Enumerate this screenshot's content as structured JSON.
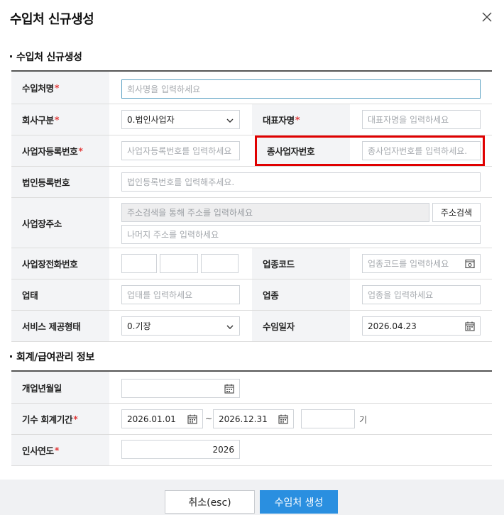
{
  "dialog": {
    "title": "수입처 신규생성",
    "close_label": "×"
  },
  "section1": {
    "heading": "수입처 신규생성",
    "fields": {
      "name_label": "수입처명",
      "name_placeholder": "회사명을 입력하세요",
      "company_type_label": "회사구분",
      "company_type_value": "0.법인사업자",
      "ceo_label": "대표자명",
      "ceo_placeholder": "대표자명을 입력하세요",
      "biz_no_label": "사업자등록번호",
      "biz_no_placeholder": "사업자등록번호를 입력하세요",
      "sub_biz_no_label": "종사업자번호",
      "sub_biz_no_placeholder": "종사업자번호를 입력하세요.",
      "corp_no_label": "법인등록번호",
      "corp_no_placeholder": "법인등록번호를 입력해주세요.",
      "address_label": "사업장주소",
      "address_placeholder": "주소검색을 통해 주소를 입력하세요",
      "address_search_button": "주소검색",
      "address_detail_placeholder": "나머지 주소를 입력하세요",
      "phone_label": "사업장전화번호",
      "industry_code_label": "업종코드",
      "industry_code_placeholder": "업종코드를 입력하세요",
      "business_type_label": "업태",
      "business_type_placeholder": "업태를 입력하세요",
      "business_item_label": "업종",
      "business_item_placeholder": "업종을 입력하세요",
      "service_type_label": "서비스 제공형태",
      "service_type_value": "0.기장",
      "import_date_label": "수임일자",
      "import_date_value": "2026.04.23"
    }
  },
  "section2": {
    "heading": "회계/급여관리 정보",
    "fields": {
      "open_date_label": "개업년월일",
      "open_date_value": "",
      "fiscal_period_label": "기수 회계기간",
      "fiscal_start": "2026.01.01",
      "fiscal_separator": "~",
      "fiscal_end": "2026.12.31",
      "fiscal_term_value": "",
      "fiscal_term_suffix": "기",
      "hr_year_label": "인사연도",
      "hr_year_value": "2026"
    }
  },
  "footer": {
    "cancel_label": "취소(esc)",
    "create_label": "수임처 생성"
  },
  "required_mark": "*",
  "colors": {
    "primary": "#2a8fe0",
    "required": "#e23b3b",
    "highlight": "#e00000"
  }
}
